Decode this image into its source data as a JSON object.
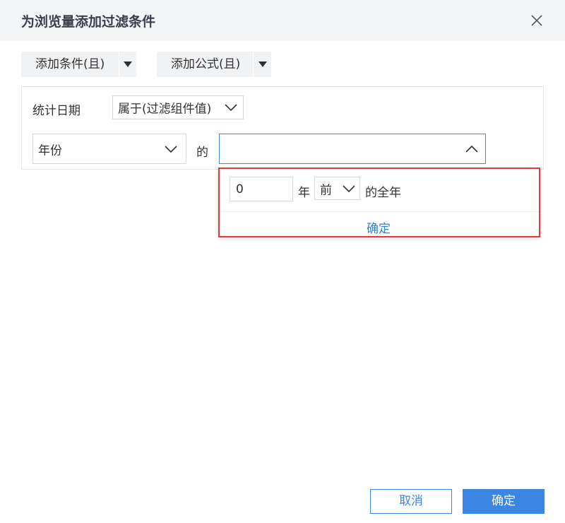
{
  "dialog": {
    "title": "为浏览量添加过滤条件",
    "close_icon": "close-icon"
  },
  "toolbar": {
    "add_condition_label": "添加条件(且)",
    "add_formula_label": "添加公式(且)",
    "dropdown_icon": "caret-down-icon"
  },
  "condition": {
    "field_label": "统计日期",
    "operator_value": "属于(过滤组件值)",
    "granularity_value": "年份",
    "connector_label": "的",
    "value_select": ""
  },
  "popup": {
    "offset_value": "0",
    "year_unit_label": "年",
    "direction_value": "前",
    "suffix_label": "的全年",
    "confirm_label": "确定"
  },
  "footer": {
    "cancel_label": "取消",
    "ok_label": "确定"
  },
  "colors": {
    "accent": "#3a86e0",
    "highlight_border": "#e03a3a",
    "header_bg": "#f4f5f7"
  }
}
